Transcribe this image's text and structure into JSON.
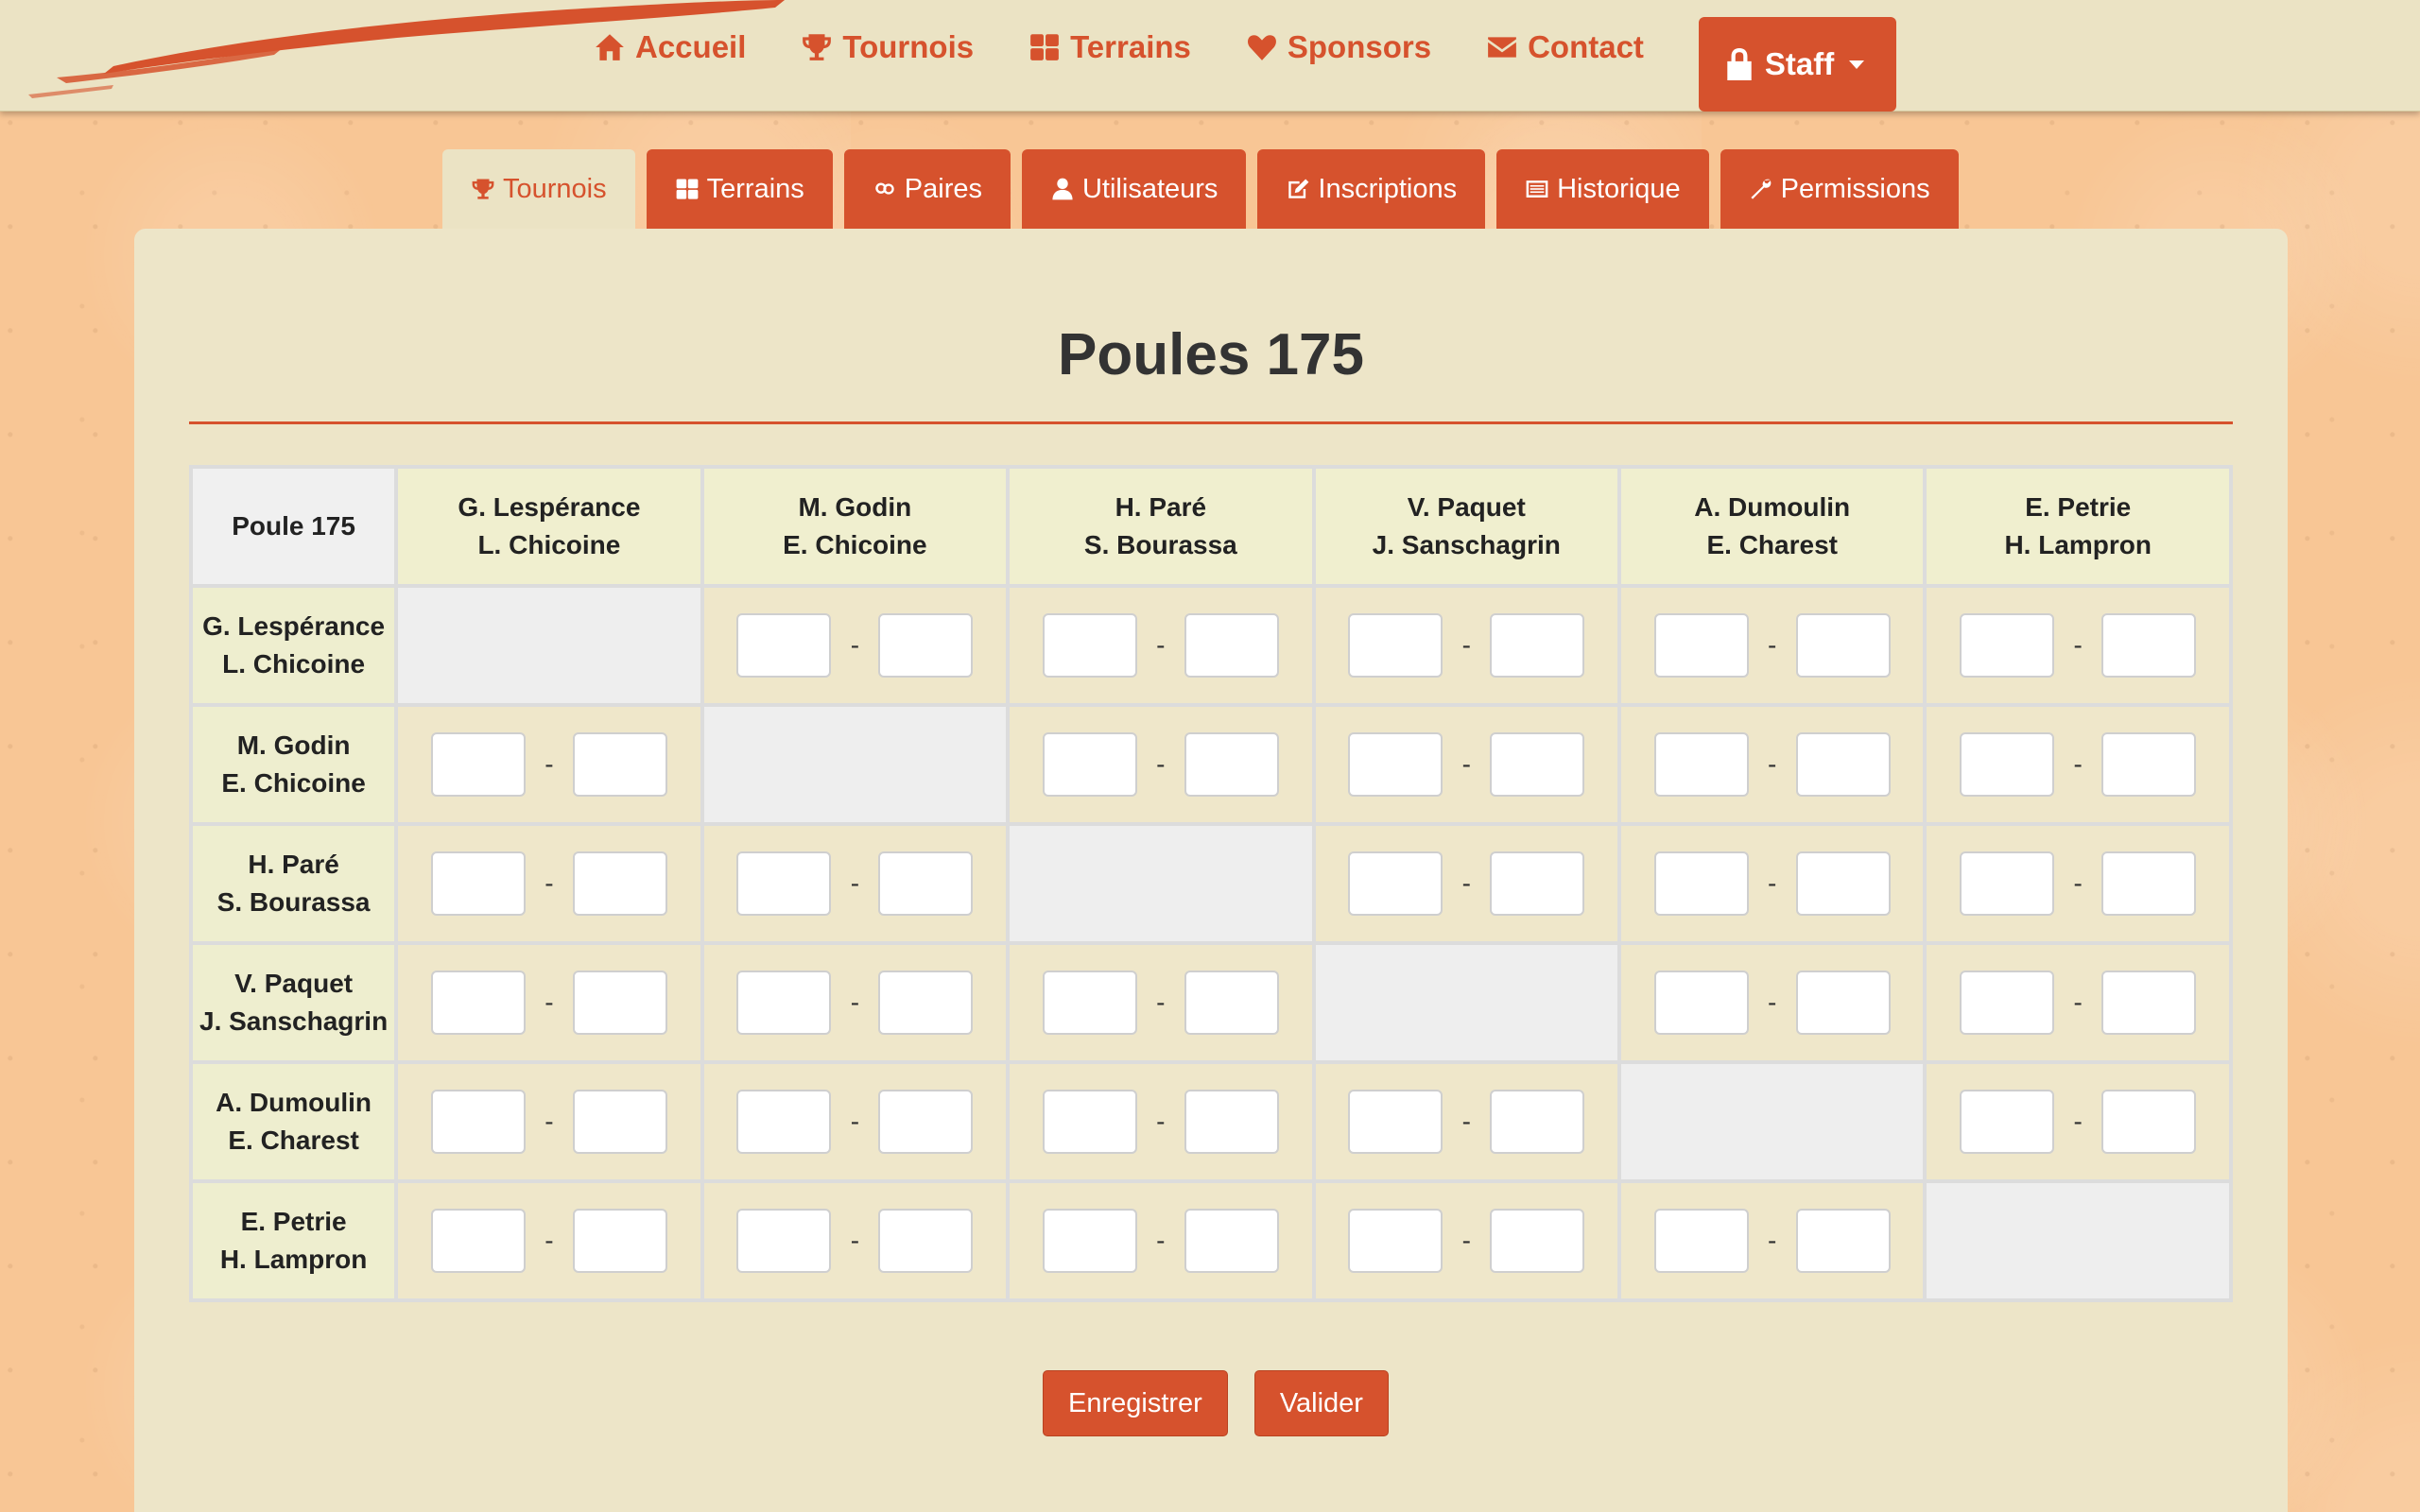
{
  "nav": {
    "items": [
      {
        "label": "Accueil",
        "icon": "home-icon"
      },
      {
        "label": "Tournois",
        "icon": "trophy-icon"
      },
      {
        "label": "Terrains",
        "icon": "grid-icon"
      },
      {
        "label": "Sponsors",
        "icon": "heart-icon"
      },
      {
        "label": "Contact",
        "icon": "envelope-icon"
      }
    ],
    "staff_label": "Staff"
  },
  "tabs": [
    {
      "label": "Tournois",
      "icon": "trophy-icon",
      "active": true
    },
    {
      "label": "Terrains",
      "icon": "grid-icon",
      "active": false
    },
    {
      "label": "Paires",
      "icon": "gender-icon",
      "active": false
    },
    {
      "label": "Utilisateurs",
      "icon": "user-icon",
      "active": false
    },
    {
      "label": "Inscriptions",
      "icon": "edit-icon",
      "active": false
    },
    {
      "label": "Historique",
      "icon": "list-icon",
      "active": false
    },
    {
      "label": "Permissions",
      "icon": "wrench-icon",
      "active": false
    }
  ],
  "page": {
    "title": "Poules 175",
    "table_corner": "Poule 175"
  },
  "pairs": [
    {
      "p1": "G. Lespérance",
      "p2": "L. Chicoine"
    },
    {
      "p1": "M. Godin",
      "p2": "E. Chicoine"
    },
    {
      "p1": "H. Paré",
      "p2": "S. Bourassa"
    },
    {
      "p1": "V. Paquet",
      "p2": "J. Sanschagrin"
    },
    {
      "p1": "A. Dumoulin",
      "p2": "E. Charest"
    },
    {
      "p1": "E. Petrie",
      "p2": "H. Lampron"
    }
  ],
  "score_separator": "-",
  "buttons": {
    "save": "Enregistrer",
    "validate": "Valider"
  },
  "colors": {
    "accent": "#d6522d",
    "panel": "#ede5c8",
    "navbar": "#ebe3c4",
    "background": "#f8c695"
  }
}
